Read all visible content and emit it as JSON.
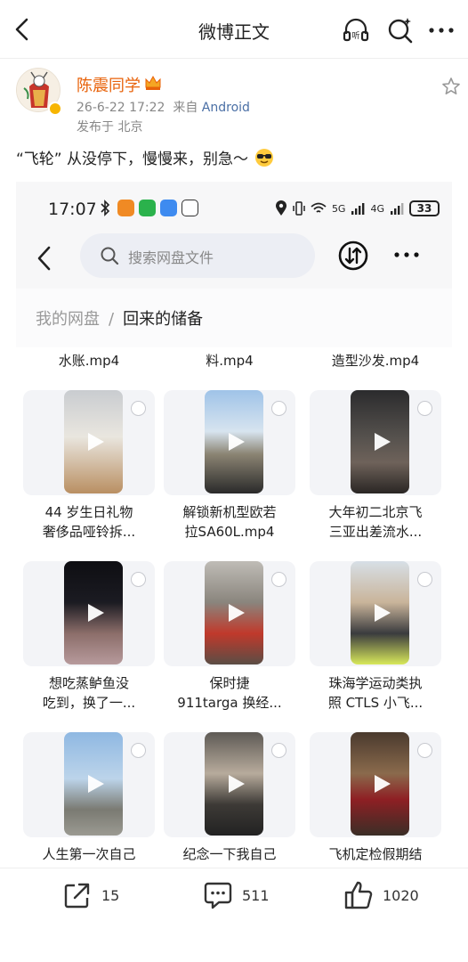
{
  "header": {
    "title": "微博正文"
  },
  "author": {
    "name": "陈震同学",
    "time": "26-6-22 17:22",
    "from_label": "来自",
    "source": "Android",
    "location": "发布于 北京"
  },
  "post": {
    "text": "“飞轮” 从没停下，慢慢来，别急～"
  },
  "screenshot": {
    "status_time": "17:07",
    "net_5g": "5G",
    "net_4g": "4G",
    "battery": "33",
    "search_placeholder": "搜索网盘文件",
    "breadcrumb_root": "我的网盘",
    "breadcrumb_sep": "/",
    "breadcrumb_current": "回来的储备",
    "partial_row": [
      "水账.mp4",
      "料.mp4",
      "造型沙发.mp4"
    ],
    "files": [
      {
        "line1": "44 岁生日礼物",
        "line2": "奢侈品哑铃拆..."
      },
      {
        "line1": "解锁新机型欧若",
        "line2": "拉SA60L.mp4"
      },
      {
        "line1": "大年初二北京飞",
        "line2": "三亚出差流水..."
      },
      {
        "line1": "想吃蒸鲈鱼没",
        "line2": "吃到，换了一..."
      },
      {
        "line1": "保时捷",
        "line2": "911targa 换经..."
      },
      {
        "line1": "珠海学运动类执",
        "line2": "照 CTLS 小飞..."
      },
      {
        "line1": "人生第一次自己",
        "line2": ""
      },
      {
        "line1": "纪念一下我自己",
        "line2": ""
      },
      {
        "line1": "飞机定检假期结",
        "line2": ""
      }
    ]
  },
  "actions": {
    "share_count": "15",
    "comment_count": "511",
    "like_count": "1020"
  },
  "colors": {
    "username": "#e8620a",
    "source_link": "#4a6fa5",
    "verify": "#f7b500"
  }
}
